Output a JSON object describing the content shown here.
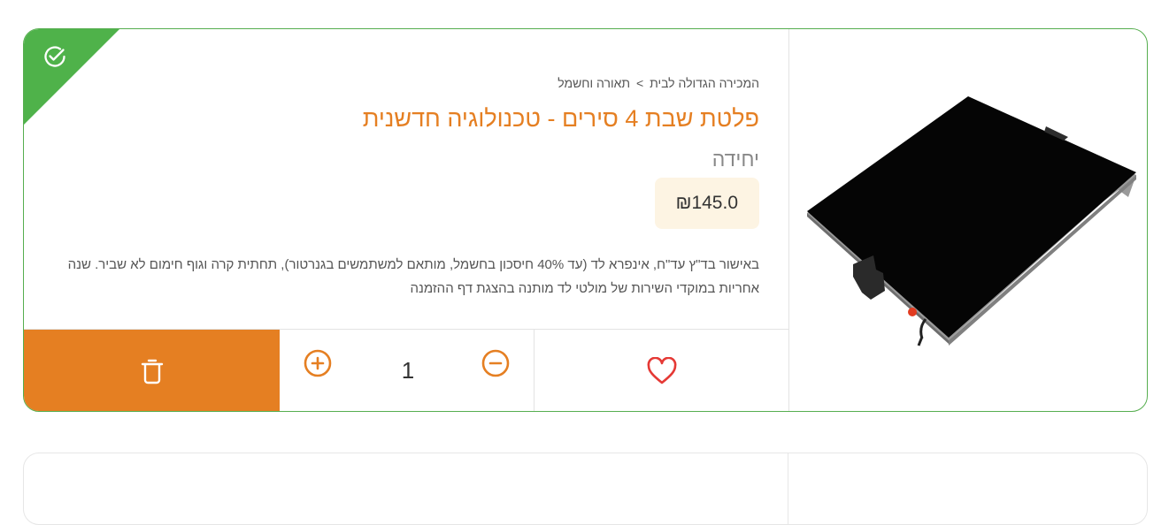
{
  "product": {
    "breadcrumb": {
      "category": "המכירה הגדולה לבית",
      "separator": ">",
      "subcategory": "תאורה וחשמל"
    },
    "title": "פלטת שבת 4 סירים - טכנולוגיה חדשנית",
    "unit": "יחידה",
    "price": "₪145.0",
    "description": "באישור בד\"ץ עד\"ח, אינפרא לד (עד 40% חיסכון בחשמל, מותאם למשתמשים בגנרטור), תחתית קרה וגוף חימום לא שביר. שנה אחריות במוקדי השירות של מולטי לד מותנה בהצגת דף ההזמנה",
    "quantity": "1",
    "selected": true
  },
  "icons": {
    "selected": "check-circle-icon",
    "delete": "trash-icon",
    "increase": "plus-circle-icon",
    "decrease": "minus-circle-icon",
    "favorite": "heart-icon",
    "image": "hot-plate-image"
  },
  "colors": {
    "accent": "#e57f22",
    "selected_border": "#56ae4f",
    "badge": "#4fb24a",
    "price_bg": "#fdf4e3",
    "heart": "#e53935"
  }
}
